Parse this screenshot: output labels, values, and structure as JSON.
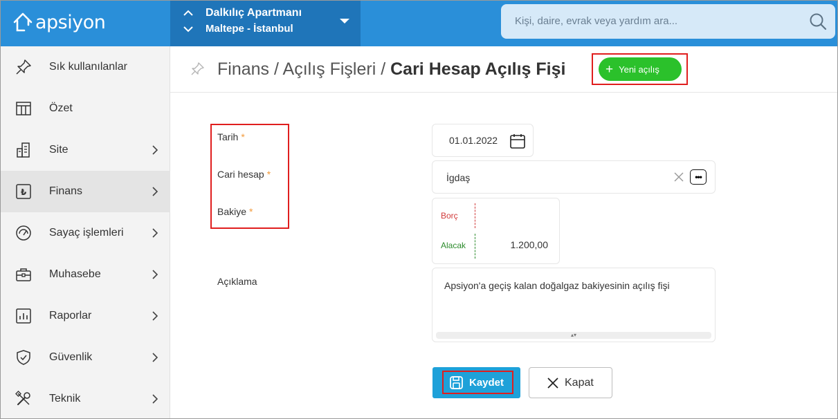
{
  "app": {
    "logo_text": "apsiyon"
  },
  "site_switcher": {
    "name": "Dalkılıç Apartmanı",
    "location": "Maltepe - İstanbul"
  },
  "search": {
    "placeholder": "Kişi, daire, evrak veya yardım ara..."
  },
  "sidebar": {
    "items": [
      {
        "label": "Sık kullanılanlar",
        "icon": "pin-icon"
      },
      {
        "label": "Özet",
        "icon": "table-icon"
      },
      {
        "label": "Site",
        "icon": "building-icon"
      },
      {
        "label": "Finans",
        "icon": "lira-icon"
      },
      {
        "label": "Sayaç işlemleri",
        "icon": "gauge-icon"
      },
      {
        "label": "Muhasebe",
        "icon": "briefcase-icon"
      },
      {
        "label": "Raporlar",
        "icon": "chart-icon"
      },
      {
        "label": "Güvenlik",
        "icon": "shield-icon"
      },
      {
        "label": "Teknik",
        "icon": "tools-icon"
      }
    ],
    "active": "Finans"
  },
  "header": {
    "breadcrumb_1": "Finans",
    "breadcrumb_2": "Açılış Fişleri",
    "current": "Cari Hesap Açılış Fişi",
    "separator": "/",
    "new_button_label": "Yeni açılış"
  },
  "form": {
    "date_label": "Tarih",
    "date_value": "01.01.2022",
    "account_label": "Cari hesap",
    "account_value": "İgdaş",
    "balance_label": "Bakiye",
    "debit_label": "Borç",
    "credit_label": "Alacak",
    "credit_value": "1.200,00",
    "description_label": "Açıklama",
    "description_value": "Apsiyon'a geçiş kalan doğalgaz bakiyesinin açılış fişi",
    "required_mark": "*"
  },
  "actions": {
    "save_label": "Kaydet",
    "close_label": "Kapat"
  },
  "colors": {
    "topbar": "#2a8fd9",
    "site_switcher": "#1f75b9",
    "new_button": "#2bc12b",
    "save_button": "#1ea1d9",
    "highlight": "#e01e1e"
  }
}
